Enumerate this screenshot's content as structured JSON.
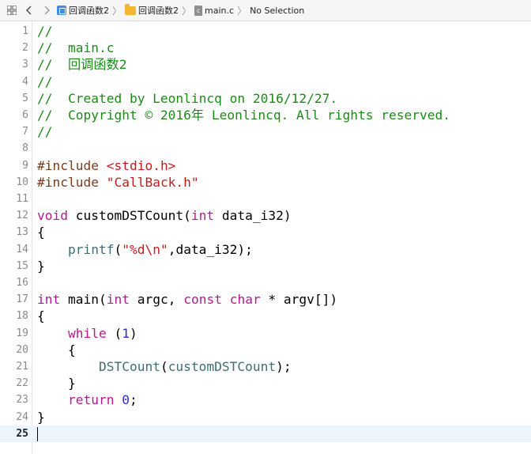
{
  "jumpbar": {
    "crumbs": [
      "回调函数2",
      "回调函数2",
      "main.c",
      "No Selection"
    ],
    "file_badge": "c"
  },
  "editor": {
    "current_line": 25,
    "lines": [
      {
        "n": "1",
        "tokens": [
          {
            "t": "//",
            "c": "com"
          }
        ]
      },
      {
        "n": "2",
        "tokens": [
          {
            "t": "//  main.c",
            "c": "com"
          }
        ]
      },
      {
        "n": "3",
        "tokens": [
          {
            "t": "//  回调函数2",
            "c": "com"
          }
        ]
      },
      {
        "n": "4",
        "tokens": [
          {
            "t": "//",
            "c": "com"
          }
        ]
      },
      {
        "n": "5",
        "tokens": [
          {
            "t": "//  Created by Leonlincq on 2016/12/27.",
            "c": "com"
          }
        ]
      },
      {
        "n": "6",
        "tokens": [
          {
            "t": "//  Copyright © 2016年 Leonlincq. All rights reserved.",
            "c": "com"
          }
        ]
      },
      {
        "n": "7",
        "tokens": [
          {
            "t": "//",
            "c": "com"
          }
        ]
      },
      {
        "n": "8",
        "tokens": []
      },
      {
        "n": "9",
        "tokens": [
          {
            "t": "#include ",
            "c": "pre"
          },
          {
            "t": "<stdio.h>",
            "c": "str"
          }
        ]
      },
      {
        "n": "10",
        "tokens": [
          {
            "t": "#include ",
            "c": "pre"
          },
          {
            "t": "\"CallBack.h\"",
            "c": "str"
          }
        ]
      },
      {
        "n": "11",
        "tokens": []
      },
      {
        "n": "12",
        "tokens": [
          {
            "t": "void",
            "c": "kw"
          },
          {
            "t": " customDSTCount(",
            "c": ""
          },
          {
            "t": "int",
            "c": "kw"
          },
          {
            "t": " data_i32)",
            "c": ""
          }
        ]
      },
      {
        "n": "13",
        "tokens": [
          {
            "t": "{",
            "c": ""
          }
        ]
      },
      {
        "n": "14",
        "tokens": [
          {
            "t": "    ",
            "c": ""
          },
          {
            "t": "printf",
            "c": "fn"
          },
          {
            "t": "(",
            "c": ""
          },
          {
            "t": "\"%d\\n\"",
            "c": "str"
          },
          {
            "t": ",data_i32);",
            "c": ""
          }
        ]
      },
      {
        "n": "15",
        "tokens": [
          {
            "t": "}",
            "c": ""
          }
        ]
      },
      {
        "n": "16",
        "tokens": []
      },
      {
        "n": "17",
        "tokens": [
          {
            "t": "int",
            "c": "kw"
          },
          {
            "t": " main(",
            "c": ""
          },
          {
            "t": "int",
            "c": "kw"
          },
          {
            "t": " argc, ",
            "c": ""
          },
          {
            "t": "const",
            "c": "kw"
          },
          {
            "t": " ",
            "c": ""
          },
          {
            "t": "char",
            "c": "kw"
          },
          {
            "t": " * argv[])",
            "c": ""
          }
        ]
      },
      {
        "n": "18",
        "tokens": [
          {
            "t": "{",
            "c": ""
          }
        ]
      },
      {
        "n": "19",
        "tokens": [
          {
            "t": "    ",
            "c": ""
          },
          {
            "t": "while",
            "c": "kw"
          },
          {
            "t": " (",
            "c": ""
          },
          {
            "t": "1",
            "c": "num"
          },
          {
            "t": ")",
            "c": ""
          }
        ]
      },
      {
        "n": "20",
        "tokens": [
          {
            "t": "    {",
            "c": ""
          }
        ]
      },
      {
        "n": "21",
        "tokens": [
          {
            "t": "        ",
            "c": ""
          },
          {
            "t": "DSTCount",
            "c": "fn"
          },
          {
            "t": "(",
            "c": ""
          },
          {
            "t": "customDSTCount",
            "c": "fn"
          },
          {
            "t": ");",
            "c": ""
          }
        ]
      },
      {
        "n": "22",
        "tokens": [
          {
            "t": "    }",
            "c": ""
          }
        ]
      },
      {
        "n": "23",
        "tokens": [
          {
            "t": "    ",
            "c": ""
          },
          {
            "t": "return",
            "c": "kw"
          },
          {
            "t": " ",
            "c": ""
          },
          {
            "t": "0",
            "c": "num"
          },
          {
            "t": ";",
            "c": ""
          }
        ]
      },
      {
        "n": "24",
        "tokens": [
          {
            "t": "}",
            "c": ""
          }
        ]
      },
      {
        "n": "25",
        "tokens": []
      }
    ]
  }
}
